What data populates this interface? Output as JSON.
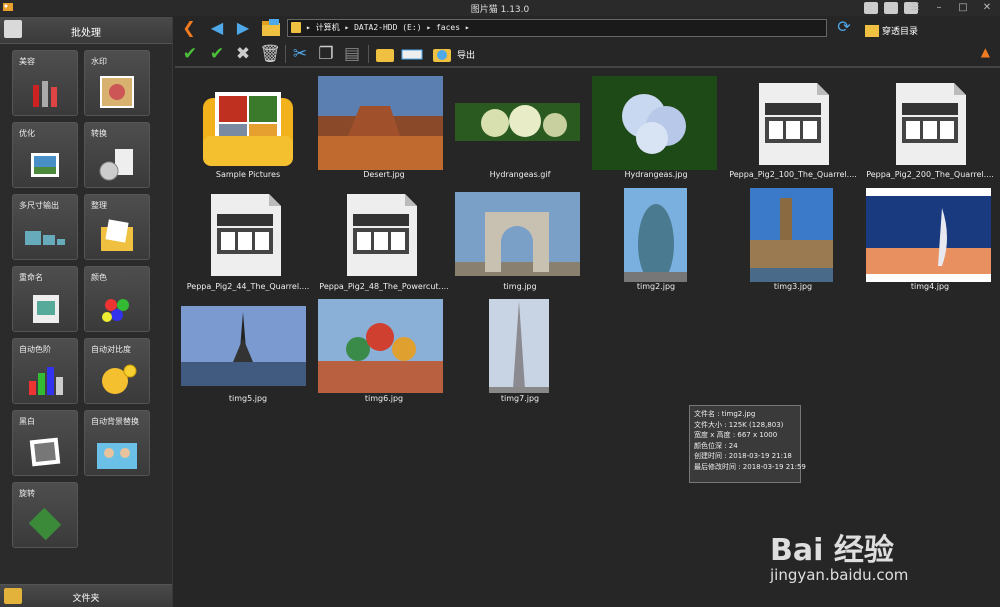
{
  "window": {
    "title": "图片猫 1.13.0"
  },
  "sidebar": {
    "header": "批处理",
    "footer": "文件夹",
    "tools": [
      {
        "label": "美容"
      },
      {
        "label": "水印"
      },
      {
        "label": "优化"
      },
      {
        "label": "转换"
      },
      {
        "label": "多尺寸输出"
      },
      {
        "label": "整理"
      },
      {
        "label": "重命名"
      },
      {
        "label": "颜色"
      },
      {
        "label": "自动色阶"
      },
      {
        "label": "自动对比度"
      },
      {
        "label": "黑白"
      },
      {
        "label": "自动背景替换"
      },
      {
        "label": "旋转"
      }
    ]
  },
  "nav": {
    "back_icon": "arrow-left-icon",
    "path": "▸ 计算机 ▸ DATA2-HDD (E:) ▸ faces ▸",
    "through_dir": "穿透目录"
  },
  "toolbar": {
    "export_label": "导出"
  },
  "files": [
    {
      "name": "Sample Pictures"
    },
    {
      "name": "Desert.jpg"
    },
    {
      "name": "Hydrangeas.gif"
    },
    {
      "name": "Hydrangeas.jpg"
    },
    {
      "name": "Peppa_Pig2_100_The_Quarrel...."
    },
    {
      "name": "Peppa_Pig2_200_The_Quarrel...."
    },
    {
      "name": "Peppa_Pig2_44_The_Quarrel...."
    },
    {
      "name": "Peppa_Pig2_48_The_Powercut...."
    },
    {
      "name": "timg.jpg"
    },
    {
      "name": "timg2.jpg"
    },
    {
      "name": "timg3.jpg"
    },
    {
      "name": "timg4.jpg"
    },
    {
      "name": "timg5.jpg"
    },
    {
      "name": "timg6.jpg"
    },
    {
      "name": "timg7.jpg"
    }
  ],
  "tooltip": {
    "line1": "文件名 : timg2.jpg",
    "line2": "文件大小 : 125K (128,803)",
    "line3": "宽度 x 高度 : 667 x 1000",
    "line4": "颜色位深 : 24",
    "line5": "创建时间 : 2018-03-19 21:18",
    "line6": "最后修改时间 : 2018-03-19 21:59"
  },
  "watermark": {
    "brand": "Bai 经验",
    "url": "jingyan.baidu.com"
  }
}
